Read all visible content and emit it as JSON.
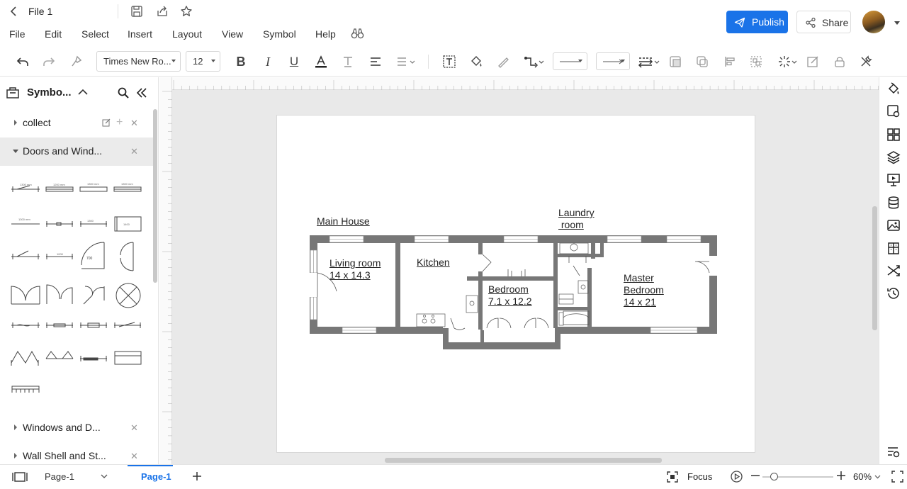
{
  "app": {
    "file_title": "File 1",
    "menu": [
      "File",
      "Edit",
      "Select",
      "Insert",
      "Layout",
      "View",
      "Symbol",
      "Help"
    ],
    "publish_label": "Publish",
    "share_label": "Share"
  },
  "toolbar": {
    "font_family": "Times New Ro...",
    "font_size": "12"
  },
  "sidebar": {
    "title": "Symbo...",
    "libraries": [
      {
        "name": "collect",
        "expanded": false
      },
      {
        "name": "Doors and Wind...",
        "expanded": true
      },
      {
        "name": "Windows and D...",
        "expanded": false
      },
      {
        "name": "Wall Shell and St...",
        "expanded": false
      }
    ]
  },
  "canvas": {
    "labels": {
      "main_house": "Main House",
      "laundry": "Laundry\n room",
      "living": "Living room\n14 x 14.3",
      "kitchen": "Kitchen",
      "bedroom": "Bedroom\n7.1 x 12.2",
      "master": "Master\nBedroom\n14 x 21"
    }
  },
  "statusbar": {
    "page_select": "Page-1",
    "active_tab": "Page-1",
    "focus_label": "Focus",
    "zoom": "60%"
  }
}
